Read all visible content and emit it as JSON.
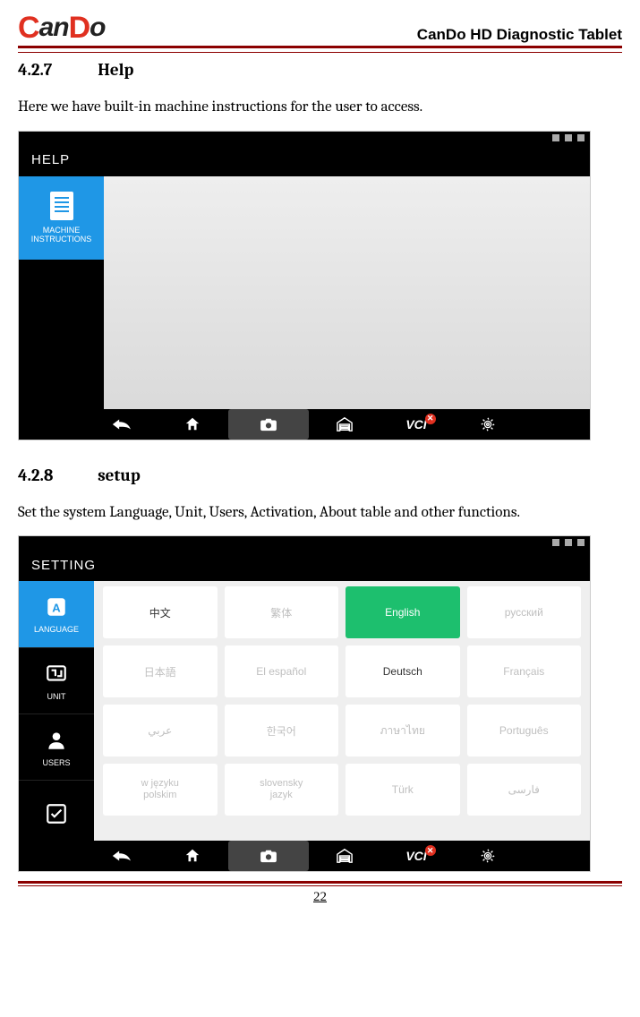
{
  "header": {
    "logo_text_prefix": "an",
    "logo_text_mid": "D",
    "logo_text_suffix": "o",
    "title": "CanDo HD Diagnostic Tablet"
  },
  "sections": [
    {
      "number": "4.2.7",
      "title": "Help",
      "body": "Here we have built-in machine instructions for the user to access."
    },
    {
      "number": "4.2.8",
      "title": "setup",
      "body": "Set the system Language, Unit, Users, Activation, About table and other functions."
    }
  ],
  "help_screen": {
    "title": "HELP",
    "sidebar_item": "MACHINE\nINSTRUCTIONS",
    "nav_vci": "VCI"
  },
  "setting_screen": {
    "title": "SETTING",
    "sidebar": [
      {
        "label": "LANGUAGE",
        "active": true,
        "icon": "lang"
      },
      {
        "label": "UNIT",
        "active": false,
        "icon": "unit"
      },
      {
        "label": "USERS",
        "active": false,
        "icon": "user"
      },
      {
        "label": "",
        "active": false,
        "icon": "check"
      }
    ],
    "languages": [
      [
        {
          "label": "中文",
          "style": "dark"
        },
        {
          "label": "繁体",
          "style": ""
        },
        {
          "label": "English",
          "style": "selected"
        },
        {
          "label": "русский",
          "style": ""
        }
      ],
      [
        {
          "label": "日本語",
          "style": ""
        },
        {
          "label": "El español",
          "style": ""
        },
        {
          "label": "Deutsch",
          "style": "dark"
        },
        {
          "label": "Français",
          "style": ""
        }
      ],
      [
        {
          "label": "عربي",
          "style": ""
        },
        {
          "label": "한국어",
          "style": ""
        },
        {
          "label": "ภาษาไทย",
          "style": ""
        },
        {
          "label": "Português",
          "style": ""
        }
      ],
      [
        {
          "label": "w języku\npolskim",
          "style": "multiline"
        },
        {
          "label": "slovensky\njazyk",
          "style": "multiline"
        },
        {
          "label": "Türk",
          "style": ""
        },
        {
          "label": "فارسی",
          "style": ""
        }
      ]
    ],
    "nav_vci": "VCI"
  },
  "page_number": "22"
}
